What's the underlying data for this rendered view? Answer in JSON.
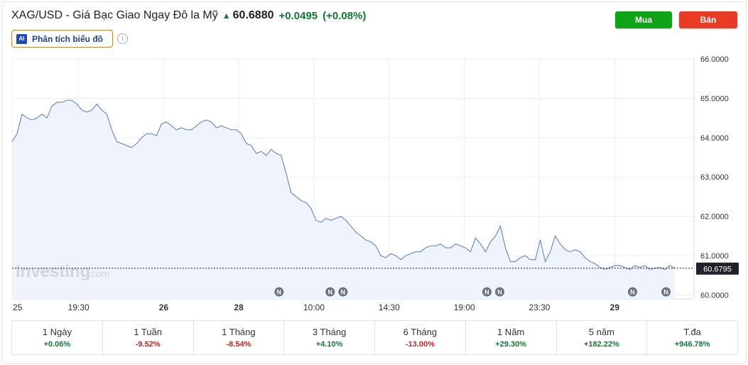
{
  "header": {
    "title": "XAG/USD - Giá Bạc Giao Ngay Đô la Mỹ",
    "price": "60.6880",
    "change": "+0.0495",
    "change_pct": "(+0.08%)"
  },
  "analysis_button": {
    "label": "Phân tích biểu đồ",
    "badge": "AI"
  },
  "info_icon": "i",
  "trade": {
    "buy_label": "Mua",
    "sell_label": "Bán"
  },
  "chart_data": {
    "type": "area",
    "title": "",
    "xlabel": "",
    "ylabel": "",
    "ylim": [
      59.9,
      66.0
    ],
    "y_ticks": [
      "66.0000",
      "65.0000",
      "64.0000",
      "63.0000",
      "62.0000",
      "61.0000",
      "60.0000"
    ],
    "x_ticks": [
      {
        "label": "25",
        "pos": 0.0,
        "bold": false
      },
      {
        "label": "19:30",
        "pos": 0.0976,
        "bold": false
      },
      {
        "label": "26",
        "pos": 0.2223,
        "bold": true
      },
      {
        "label": "28",
        "pos": 0.3324,
        "bold": true
      },
      {
        "label": "10:00",
        "pos": 0.4427,
        "bold": false
      },
      {
        "label": "14:30",
        "pos": 0.5529,
        "bold": false
      },
      {
        "label": "19:00",
        "pos": 0.6632,
        "bold": false
      },
      {
        "label": "23:30",
        "pos": 0.7734,
        "bold": false
      },
      {
        "label": "29",
        "pos": 0.8837,
        "bold": true
      }
    ],
    "last_price": "60.6795",
    "last_value": 60.6795,
    "watermark": "Investing",
    "watermark_suffix": ".com",
    "news_marker_label": "N",
    "news_markers": [
      0.3915,
      0.4664,
      0.4853,
      0.6963,
      0.7151,
      0.9099,
      0.9589
    ],
    "series": [
      {
        "values": [
          63.9,
          64.1,
          64.6,
          64.5,
          64.45,
          64.5,
          64.6,
          64.5,
          64.8,
          64.9,
          64.9,
          64.95,
          64.95,
          64.85,
          64.7,
          64.65,
          64.7,
          64.85,
          64.7,
          64.6,
          64.2,
          63.9,
          63.85,
          63.8,
          63.75,
          63.85,
          64.0,
          64.1,
          64.1,
          64.05,
          64.35,
          64.4,
          64.3,
          64.2,
          64.25,
          64.2,
          64.2,
          64.3,
          64.4,
          64.45,
          64.4,
          64.25,
          64.3,
          64.25,
          64.2,
          64.2,
          64.1,
          63.85,
          63.8,
          63.6,
          63.65,
          63.55,
          63.7,
          63.6,
          63.55,
          63.1,
          62.6,
          62.5,
          62.4,
          62.35,
          62.2,
          61.9,
          61.85,
          61.95,
          61.9,
          61.95,
          62.0,
          61.9,
          61.75,
          61.6,
          61.5,
          61.4,
          61.35,
          61.25,
          61.0,
          60.95,
          61.05,
          61.0,
          60.9,
          61.0,
          61.05,
          61.1,
          61.1,
          61.2,
          61.25,
          61.25,
          61.3,
          61.2,
          61.2,
          61.3,
          61.25,
          61.2,
          61.1,
          61.45,
          61.3,
          61.1,
          61.35,
          61.5,
          61.75,
          61.2,
          60.85,
          60.85,
          60.95,
          61.0,
          60.9,
          60.9,
          61.4,
          60.85,
          61.1,
          61.5,
          61.3,
          61.15,
          61.1,
          61.15,
          61.1,
          60.95,
          60.85,
          60.8,
          60.7,
          60.65,
          60.7,
          60.75,
          60.75,
          60.7,
          60.65,
          60.75,
          60.7,
          60.75,
          60.65,
          60.68,
          60.7,
          60.65,
          60.75,
          60.68
        ]
      }
    ]
  },
  "performance": [
    {
      "label": "1 Ngày",
      "value": "+0.06%",
      "color": "#0e7a34"
    },
    {
      "label": "1 Tuần",
      "value": "-9.52%",
      "color": "#d91e18"
    },
    {
      "label": "1 Tháng",
      "value": "-8.54%",
      "color": "#d91e18"
    },
    {
      "label": "3 Tháng",
      "value": "+4.10%",
      "color": "#0e7a34"
    },
    {
      "label": "6 Tháng",
      "value": "-13.00%",
      "color": "#d91e18"
    },
    {
      "label": "1 Năm",
      "value": "+29.30%",
      "color": "#0e7a34"
    },
    {
      "label": "5 năm",
      "value": "+182.22%",
      "color": "#0e7a34"
    },
    {
      "label": "T.đa",
      "value": "+946.78%",
      "color": "#0e7a34"
    }
  ],
  "colors": {
    "positive": "#0e7a34",
    "negative": "#d91e18",
    "line": "#6f8fb5",
    "area": "#eef3fc",
    "buy": "#0fa316",
    "sell": "#e83a24"
  }
}
